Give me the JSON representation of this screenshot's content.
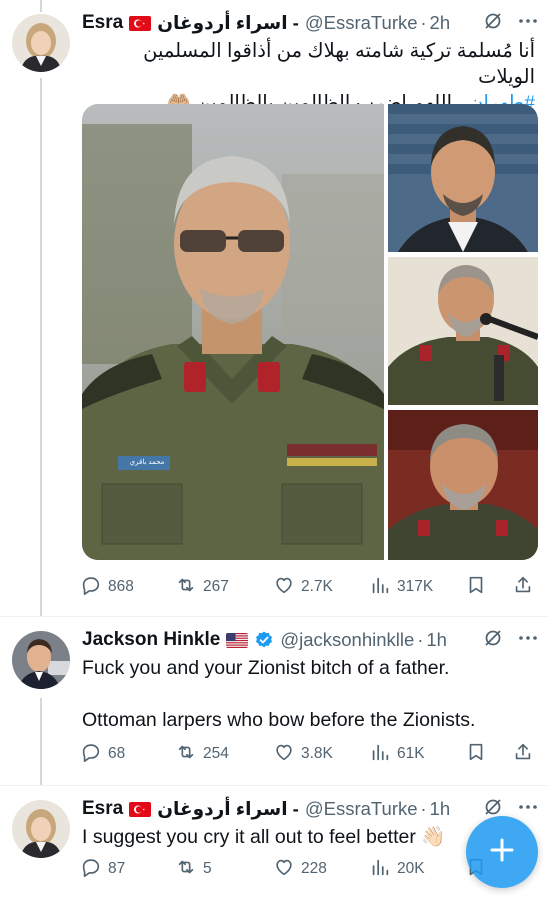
{
  "tweets": [
    {
      "display_name": "Esra",
      "arabic_name": "اسراء أردوغان -",
      "flag": "turkey-flag",
      "handle": "@EssraTurke",
      "time": "2h",
      "text_line1": "أنا مُسلمة تركية شامته بهلاك من أذاقوا المسلمين الويلات",
      "text_line2_main": "، اللهم اضرب الظالمين بالظالمين 🤲🏼",
      "hashtag": "#طهران",
      "media_caption_text": "محمد باقري",
      "stats": {
        "replies": "868",
        "reposts": "267",
        "likes": "2.7K",
        "views": "317K"
      }
    },
    {
      "display_name": "Jackson Hinkle",
      "flag": "usa-flag",
      "verified": true,
      "handle": "@jacksonhinklle",
      "time": "1h",
      "text_line1": "Fuck you and your Zionist bitch of a father.",
      "text_line2": "Ottoman larpers who bow before the Zionists.",
      "stats": {
        "replies": "68",
        "reposts": "254",
        "likes": "3.8K",
        "views": "61K"
      }
    },
    {
      "display_name": "Esra",
      "arabic_name": "اسراء أردوغان -",
      "flag": "turkey-flag",
      "handle": "@EssraTurke",
      "time": "1h",
      "text_line1": "I suggest you cry it all out to feel better 👋🏻",
      "stats": {
        "replies": "87",
        "reposts": "5",
        "likes": "228",
        "views": "20K"
      }
    }
  ],
  "separator": "·",
  "colors": {
    "accent": "#1d9bf0",
    "muted": "#536471",
    "text": "#0f1419",
    "border": "#eff3f4",
    "thread": "#cfd9de"
  },
  "icons": [
    "grok-icon",
    "more-icon",
    "reply-icon",
    "repost-icon",
    "like-icon",
    "views-icon",
    "bookmark-icon",
    "share-icon",
    "verified-badge-icon",
    "compose-plus-icon"
  ]
}
